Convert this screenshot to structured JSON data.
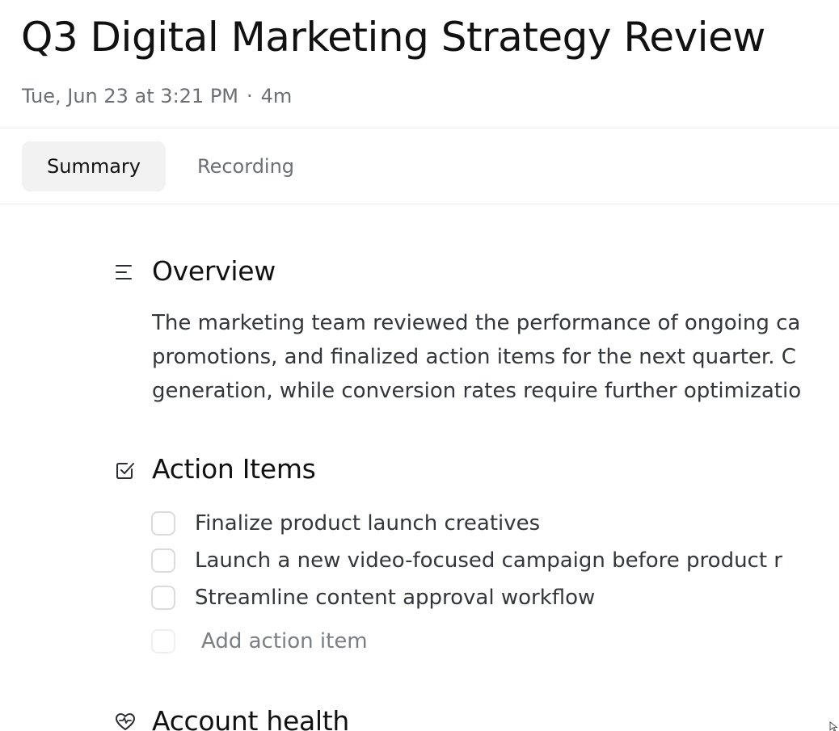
{
  "header": {
    "title": "Q3 Digital Marketing Strategy Review",
    "date": "Tue, Jun 23 at 3:21 PM",
    "separator": "·",
    "duration": "4m"
  },
  "tabs": [
    {
      "label": "Summary",
      "active": true
    },
    {
      "label": "Recording",
      "active": false
    }
  ],
  "overview": {
    "icon": "list-icon",
    "heading": "Overview",
    "lines": [
      "The marketing team reviewed the performance of ongoing ca",
      "promotions, and finalized action items for the next quarter. C",
      "generation, while conversion rates require further optimizatio"
    ]
  },
  "action_items": {
    "icon": "checkbox-check-icon",
    "heading": "Action Items",
    "items": [
      {
        "label": "Finalize product launch creatives",
        "checked": false
      },
      {
        "label": "Launch a new video-focused campaign before product r",
        "checked": false
      },
      {
        "label": "Streamline content approval workflow",
        "checked": false
      }
    ],
    "add_placeholder": "Add action item"
  },
  "account_health": {
    "icon": "heart-pulse-icon",
    "heading": "Account health"
  },
  "colors": {
    "title": "#111111",
    "muted": "#6b6f76",
    "body": "#33363b",
    "active_tab_bg": "#f2f2f2",
    "checkbox_border": "#d9dbde",
    "divider": "#ececec"
  }
}
